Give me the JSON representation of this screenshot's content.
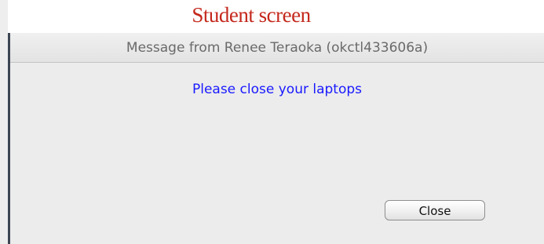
{
  "caption": "Student screen",
  "dialog": {
    "title": "Message from Renee Teraoka (okctl433606a)",
    "message": "Please close your laptops",
    "close_label": "Close"
  },
  "colors": {
    "caption": "#c4281c",
    "message": "#1a1aff",
    "dialog_background": "#ececec"
  }
}
